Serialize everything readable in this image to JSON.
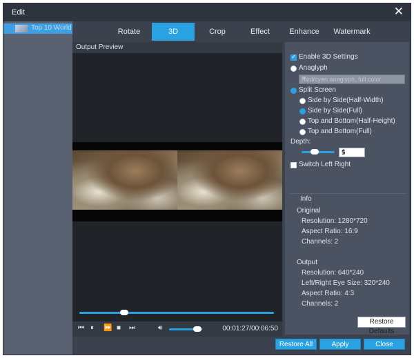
{
  "window": {
    "title": "Edit",
    "close_icon": "close-icon"
  },
  "sidebar": {
    "items": [
      {
        "label": "Top 10 World"
      }
    ]
  },
  "tabs": [
    {
      "label": "Rotate",
      "active": false
    },
    {
      "label": "3D",
      "active": true
    },
    {
      "label": "Crop",
      "active": false
    },
    {
      "label": "Effect",
      "active": false
    },
    {
      "label": "Enhance",
      "active": false
    },
    {
      "label": "Watermark",
      "active": false
    }
  ],
  "preview": {
    "label": "Output Preview"
  },
  "player": {
    "time": "00:01:27/00:06:50",
    "seek_progress": 0.23,
    "volume": 0.85
  },
  "settings3d": {
    "enable_label": "Enable 3D Settings",
    "enable_checked": true,
    "anaglyph_label": "Anaglyph",
    "anaglyph_dropdown": "Red/cyan anaglyph, full color",
    "split_label": "Split Screen",
    "split_options": [
      {
        "label": "Side by Side(Half-Width)",
        "checked": false
      },
      {
        "label": "Side by Side(Full)",
        "checked": true
      },
      {
        "label": "Top and Bottom(Half-Height)",
        "checked": false
      },
      {
        "label": "Top and Bottom(Full)",
        "checked": false
      }
    ],
    "depth_label": "Depth:",
    "depth_value": "5",
    "depth_level": 0.4,
    "switch_label": "Switch Left Right",
    "switch_checked": false
  },
  "info": {
    "heading": "Info",
    "original_heading": "Original",
    "original": [
      "Resolution: 1280*720",
      "Aspect Ratio: 16:9",
      "Channels: 2"
    ],
    "output_heading": "Output",
    "output": [
      "Resolution: 640*240",
      "Left/Right Eye Size: 320*240",
      "Aspect Ratio: 4:3",
      "Channels: 2"
    ]
  },
  "buttons": {
    "restore_defaults": "Restore Defaults",
    "restore_all": "Restore All",
    "apply": "Apply",
    "close": "Close"
  },
  "colors": {
    "accent": "#2aa1e2",
    "panel": "#4b5261",
    "background": "#3b424e"
  }
}
